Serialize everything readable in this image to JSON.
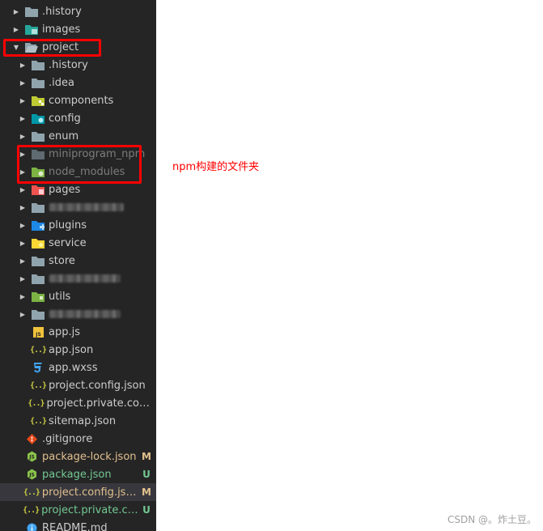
{
  "explorer": {
    "items": [
      {
        "label": ".history",
        "type": "folder",
        "icon": "folder-icon"
      },
      {
        "label": "images",
        "type": "folder",
        "icon": "folder-images-icon"
      },
      {
        "label": "project",
        "type": "folder-open",
        "icon": "folder-open-icon"
      },
      {
        "label": ".history",
        "type": "folder",
        "icon": "folder-icon"
      },
      {
        "label": ".idea",
        "type": "folder",
        "icon": "folder-icon"
      },
      {
        "label": "components",
        "type": "folder",
        "icon": "folder-components-icon"
      },
      {
        "label": "config",
        "type": "folder",
        "icon": "folder-config-icon"
      },
      {
        "label": "enum",
        "type": "folder",
        "icon": "folder-icon"
      },
      {
        "label": "miniprogram_npm",
        "type": "folder",
        "icon": "folder-icon"
      },
      {
        "label": "node_modules",
        "type": "folder",
        "icon": "folder-node-icon"
      },
      {
        "label": "pages",
        "type": "folder",
        "icon": "folder-pages-icon"
      },
      {
        "label": "",
        "type": "folder",
        "icon": "folder-icon"
      },
      {
        "label": "plugins",
        "type": "folder",
        "icon": "folder-plugins-icon"
      },
      {
        "label": "service",
        "type": "folder",
        "icon": "folder-service-icon"
      },
      {
        "label": "store",
        "type": "folder",
        "icon": "folder-icon"
      },
      {
        "label": "",
        "type": "folder",
        "icon": "folder-icon"
      },
      {
        "label": "utils",
        "type": "folder",
        "icon": "folder-utils-icon"
      },
      {
        "label": "",
        "type": "folder",
        "icon": "folder-icon"
      },
      {
        "label": "app.js",
        "type": "file",
        "icon": "js-file-icon"
      },
      {
        "label": "app.json",
        "type": "file",
        "icon": "json-file-icon"
      },
      {
        "label": "app.wxss",
        "type": "file",
        "icon": "css-file-icon"
      },
      {
        "label": "project.config.json",
        "type": "file",
        "icon": "json-file-icon"
      },
      {
        "label": "project.private.config...",
        "type": "file",
        "icon": "json-file-icon"
      },
      {
        "label": "sitemap.json",
        "type": "file",
        "icon": "json-file-icon"
      },
      {
        "label": ".gitignore",
        "type": "file",
        "icon": "git-file-icon"
      },
      {
        "label": "package-lock.json",
        "type": "file",
        "icon": "node-file-icon",
        "badge": "M"
      },
      {
        "label": "package.json",
        "type": "file",
        "icon": "node-file-icon",
        "badge": "U"
      },
      {
        "label": "project.config.json",
        "type": "file",
        "icon": "json-file-icon",
        "badge": "M"
      },
      {
        "label": "project.private.co...",
        "type": "file",
        "icon": "json-file-icon",
        "badge": "U"
      },
      {
        "label": "README.md",
        "type": "file",
        "icon": "info-file-icon"
      }
    ]
  },
  "annotation": {
    "text": "npm构建的文件夹"
  },
  "watermark": {
    "text": "CSDN @。炸土豆。"
  },
  "colors": {
    "highlight": "#ff0000",
    "annotation": "#ff0000",
    "sidebar": "#252526"
  }
}
